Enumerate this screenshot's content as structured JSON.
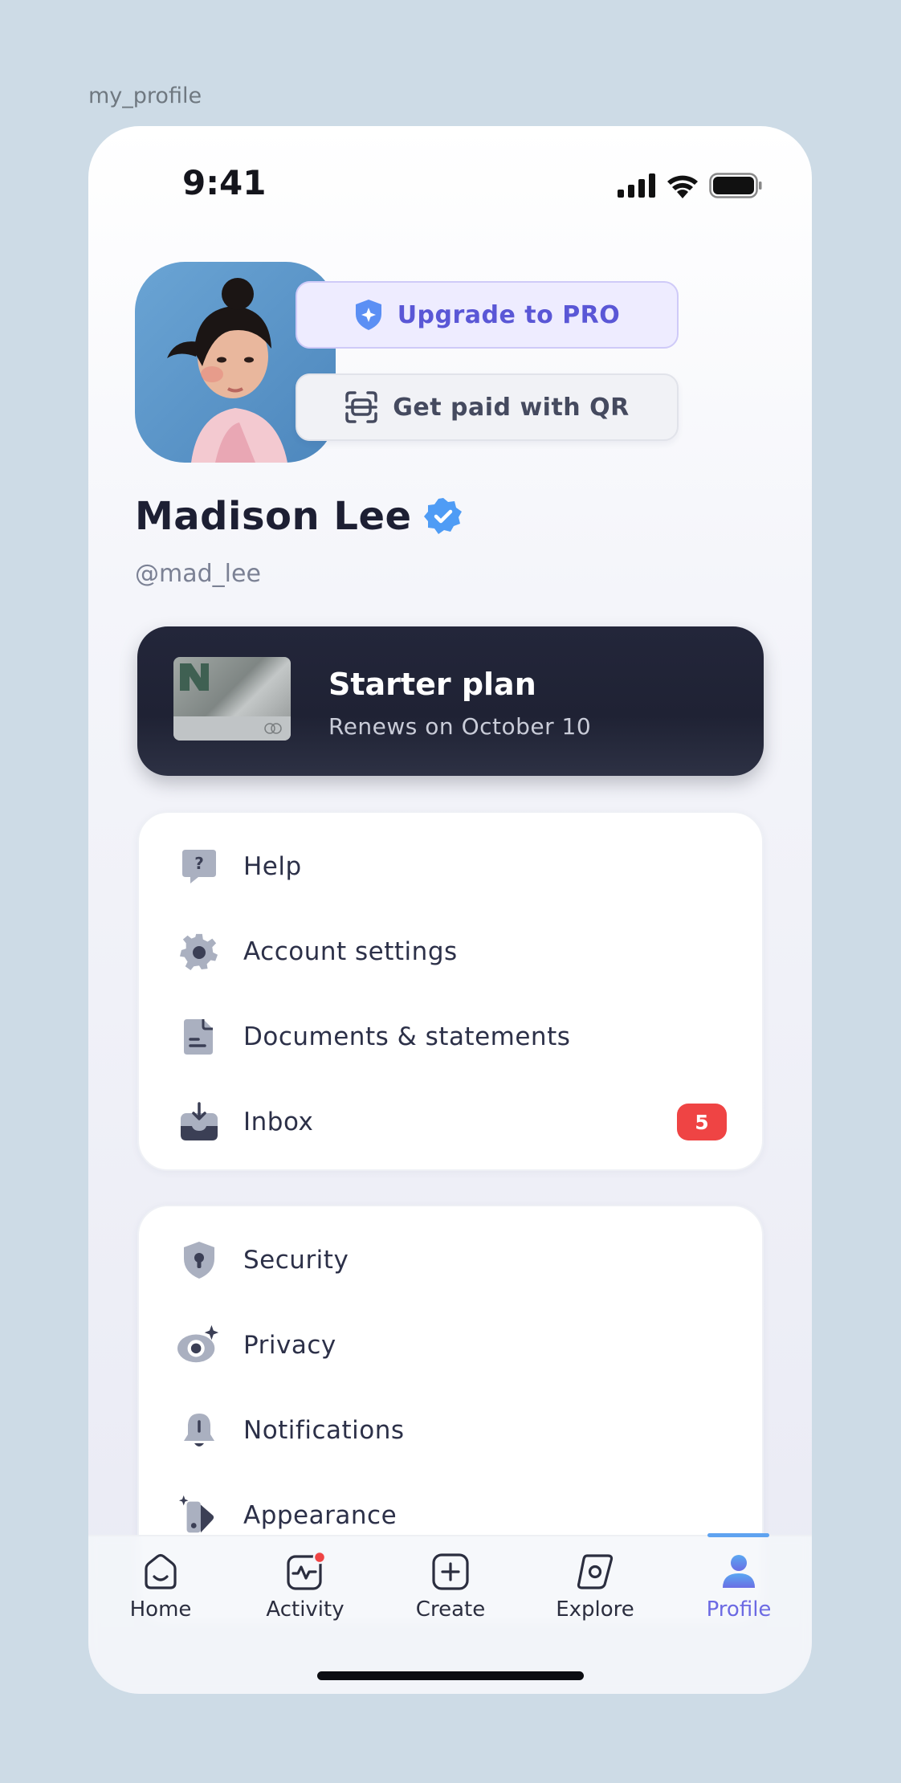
{
  "frame_label": "my_profile",
  "status_bar": {
    "time": "9:41"
  },
  "profile": {
    "name": "Madison Lee",
    "handle": "@mad_lee"
  },
  "actions": {
    "upgrade_label": "Upgrade to PRO",
    "qr_label": "Get paid with QR"
  },
  "plan": {
    "title": "Starter plan",
    "subtitle": "Renews on October 10"
  },
  "menu_primary": [
    {
      "label": "Help",
      "icon": "help-icon"
    },
    {
      "label": "Account settings",
      "icon": "gear-icon"
    },
    {
      "label": "Documents & statements",
      "icon": "document-icon"
    },
    {
      "label": "Inbox",
      "icon": "inbox-icon",
      "badge": "5"
    }
  ],
  "menu_secondary": [
    {
      "label": "Security",
      "icon": "shield-lock-icon"
    },
    {
      "label": "Privacy",
      "icon": "eye-icon"
    },
    {
      "label": "Notifications",
      "icon": "bell-icon"
    },
    {
      "label": "Appearance",
      "icon": "paint-icon"
    }
  ],
  "tabs": [
    {
      "label": "Home",
      "icon": "home-icon"
    },
    {
      "label": "Activity",
      "icon": "activity-icon"
    },
    {
      "label": "Create",
      "icon": "plus-square-icon"
    },
    {
      "label": "Explore",
      "icon": "compass-icon"
    },
    {
      "label": "Profile",
      "icon": "person-icon",
      "active": true
    }
  ],
  "colors": {
    "accent": "#6c6ae3",
    "badge": "#ef4444",
    "verified": "#4f9cf5",
    "plan_bg": "#23263a"
  }
}
